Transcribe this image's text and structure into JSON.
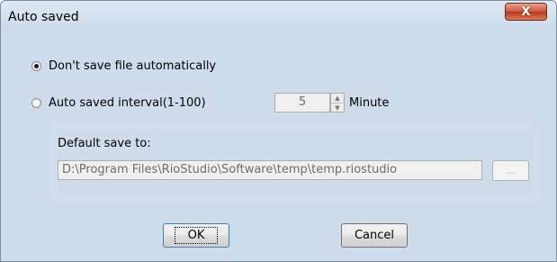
{
  "window": {
    "title": "Auto saved",
    "close_glyph": "X"
  },
  "options": {
    "no_auto_save_label": "Don't save file automatically",
    "no_auto_save_checked": true,
    "interval_label": "Auto saved interval(1-100)",
    "interval_checked": false,
    "interval_value": "5",
    "interval_unit": "Minute"
  },
  "save_location": {
    "group_label": "Default save to:",
    "path": "D:\\Program Files\\RioStudio\\Software\\temp\\temp.riostudio",
    "browse_label": "..."
  },
  "buttons": {
    "ok_label": "OK",
    "cancel_label": "Cancel"
  },
  "icons": {
    "close": "close-icon",
    "spin_up": "spin-up-icon",
    "spin_down": "spin-down-icon"
  }
}
